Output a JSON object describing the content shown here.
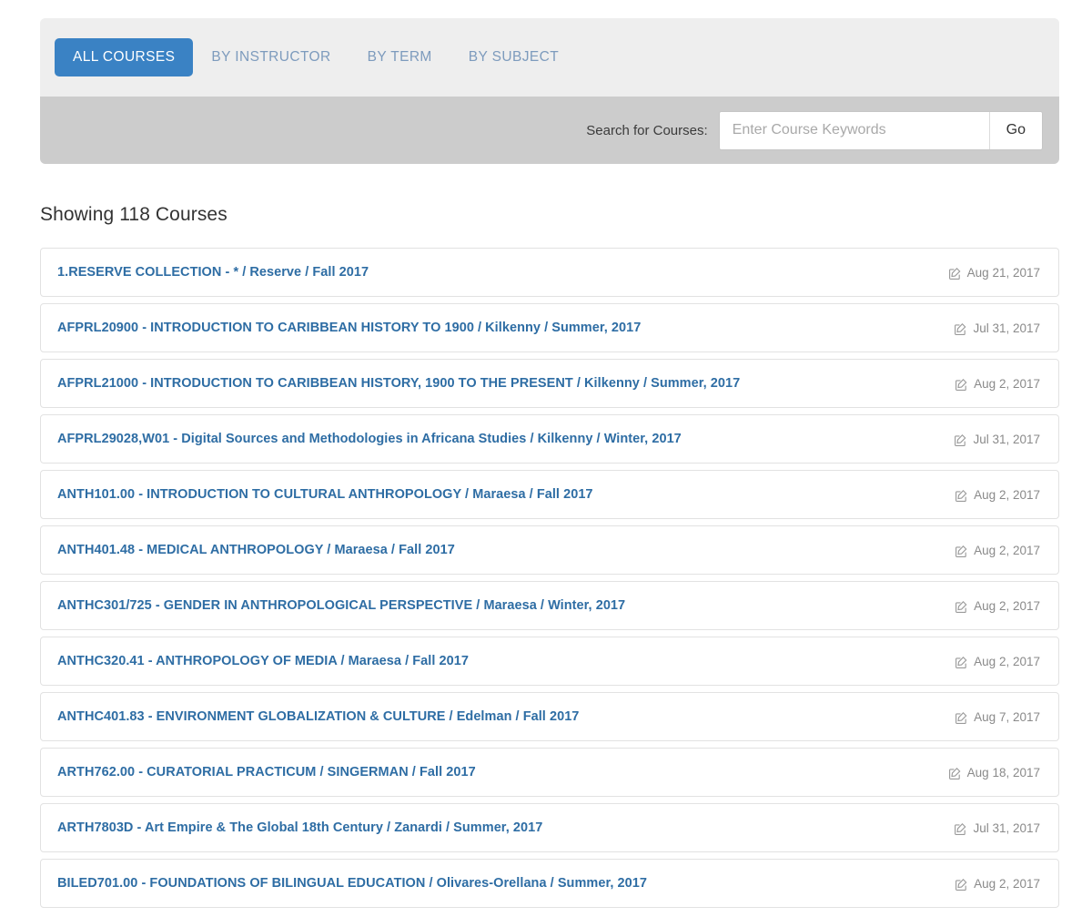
{
  "tabs": [
    {
      "label": "ALL COURSES",
      "active": true
    },
    {
      "label": "BY INSTRUCTOR",
      "active": false
    },
    {
      "label": "BY TERM",
      "active": false
    },
    {
      "label": "BY SUBJECT",
      "active": false
    }
  ],
  "search": {
    "label": "Search for Courses:",
    "placeholder": "Enter Course Keywords",
    "value": "",
    "button_label": "Go"
  },
  "results": {
    "heading": "Showing 118 Courses",
    "count": 118,
    "edit_icon": "edit-icon",
    "rows": [
      {
        "title": "1.RESERVE COLLECTION - * / Reserve / Fall 2017",
        "date": "Aug 21, 2017"
      },
      {
        "title": "AFPRL20900 - INTRODUCTION TO CARIBBEAN HISTORY TO 1900 / Kilkenny / Summer, 2017",
        "date": "Jul 31, 2017"
      },
      {
        "title": "AFPRL21000 - INTRODUCTION TO CARIBBEAN HISTORY, 1900 TO THE PRESENT / Kilkenny / Summer, 2017",
        "date": "Aug 2, 2017"
      },
      {
        "title": "AFPRL29028,W01 - Digital Sources and Methodologies in Africana Studies / Kilkenny / Winter, 2017",
        "date": "Jul 31, 2017"
      },
      {
        "title": "ANTH101.00 - INTRODUCTION TO CULTURAL ANTHROPOLOGY / Maraesa / Fall 2017",
        "date": "Aug 2, 2017"
      },
      {
        "title": "ANTH401.48 - MEDICAL ANTHROPOLOGY / Maraesa / Fall 2017",
        "date": "Aug 2, 2017"
      },
      {
        "title": "ANTHC301/725 - GENDER IN ANTHROPOLOGICAL PERSPECTIVE / Maraesa / Winter, 2017",
        "date": "Aug 2, 2017"
      },
      {
        "title": "ANTHC320.41 - ANTHROPOLOGY OF MEDIA / Maraesa / Fall 2017",
        "date": "Aug 2, 2017"
      },
      {
        "title": "ANTHC401.83 - ENVIRONMENT GLOBALIZATION & CULTURE / Edelman / Fall 2017",
        "date": "Aug 7, 2017"
      },
      {
        "title": "ARTH762.00 - CURATORIAL PRACTICUM / SINGERMAN / Fall 2017",
        "date": "Aug 18, 2017"
      },
      {
        "title": "ARTH7803D - Art Empire & The Global 18th Century / Zanardi / Summer, 2017",
        "date": "Jul 31, 2017"
      },
      {
        "title": "BILED701.00 - FOUNDATIONS OF BILINGUAL EDUCATION / Olivares-Orellana / Summer, 2017",
        "date": "Aug 2, 2017"
      }
    ]
  },
  "colors": {
    "accent": "#3a82c4",
    "link": "#2e6da4",
    "panel_top_bg": "#eeeeee",
    "panel_search_bg": "#cccccc",
    "muted_text": "#8a8a8a"
  }
}
